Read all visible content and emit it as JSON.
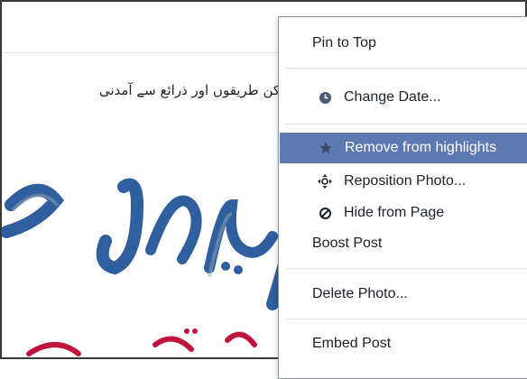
{
  "post": {
    "urdu_text": "کن طریقوں اور ذرائع سے آمدنی"
  },
  "image_text": {
    "headline": "ں کمائی ک",
    "subline": "کی ضرورت"
  },
  "context_menu": {
    "items": [
      {
        "label": "Pin to Top",
        "icon": null
      },
      {
        "label": "Change Date...",
        "icon": "clock-icon"
      },
      {
        "label": "Remove from highlights",
        "icon": "star-icon",
        "highlighted": true
      },
      {
        "label": "Reposition Photo...",
        "icon": "move-arrows-icon"
      },
      {
        "label": "Hide from Page",
        "icon": "hide-circle-icon"
      },
      {
        "label": "Boost Post",
        "icon": null
      },
      {
        "label": "Delete Photo...",
        "icon": null
      },
      {
        "label": "Embed Post",
        "icon": null
      }
    ],
    "highlight_color": "#5e79b1"
  },
  "colors": {
    "headline_blue": "#2f5f9e",
    "subline_red": "#c0143c",
    "frame_border": "#3a3a3a"
  }
}
